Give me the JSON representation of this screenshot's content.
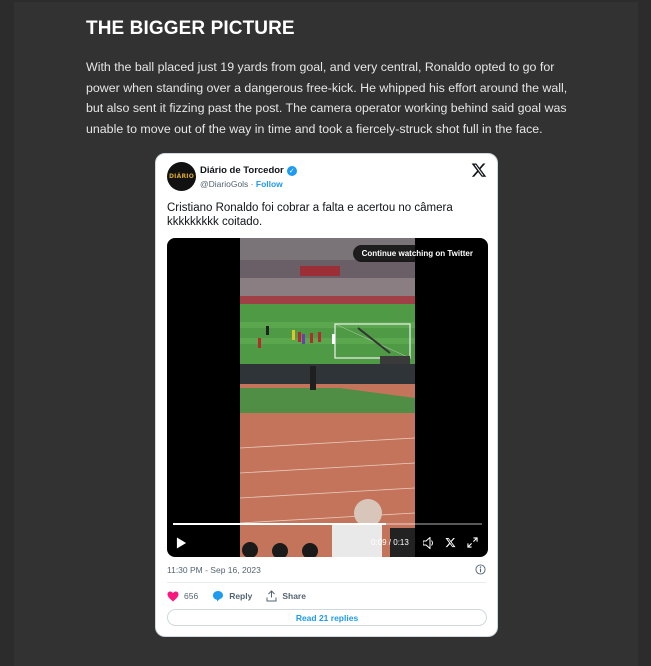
{
  "article": {
    "heading": "THE BIGGER PICTURE",
    "paragraph": "With the ball placed just 19 yards from goal, and very central, Ronaldo opted to go for power when standing over a dangerous free-kick. He whipped his effort around the wall, but also sent it fizzing past the post. The camera operator working behind said goal was unable to move out of the way in time and took a fiercely-struck shot full in the face."
  },
  "tweet": {
    "avatar_text": "DIÁRIO",
    "author_name": "Diário de Torcedor",
    "handle": "@DiarioGols",
    "separator": " · ",
    "follow_label": "Follow",
    "text": "Cristiano Ronaldo foi cobrar a falta e acertou no câmera kkkkkkkkk coitado.",
    "video": {
      "continue_label": "Continue watching on Twitter",
      "time": "0:09 / 0:13",
      "progress": 0.69
    },
    "timestamp": "11:30 PM - Sep 16, 2023",
    "likes": "656",
    "reply_label": "Reply",
    "share_label": "Share",
    "read_replies_label": "Read 21 replies"
  },
  "colors": {
    "accent": "#1d9bf0",
    "like": "#f91880",
    "background": "#2c2c2c"
  },
  "icons": [
    "verified-badge-icon",
    "x-logo-icon",
    "play-icon",
    "volume-icon",
    "x-small-icon",
    "expand-icon",
    "info-icon",
    "heart-icon",
    "reply-icon",
    "share-icon"
  ]
}
